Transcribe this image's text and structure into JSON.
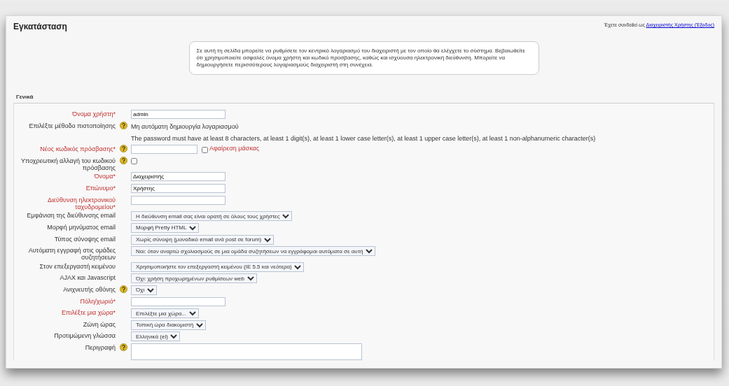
{
  "header": {
    "title": "Εγκατάσταση",
    "login_text": "Έχετε συνδεθεί ως",
    "login_link": "Διαχειριστής Χρήστης (Έξοδος)"
  },
  "intro": "Σε αυτή τη σελίδα μπορείτε να ρυθμίσετε τον κεντρικό λογαριασμό του διαχειριστή με τον οποίο θα ελέγχετε το σύστημα. Βεβαιωθείτε ότι χρησιμοποιείτε ασφαλές όνομα χρήστη και κωδικό πρόσβασης, καθώς και ισχύουσα ηλεκτρονική διεύθυνση. Μπορείτε να δημιουργήσετε περισσότερους λογαριασμούς διαχειριστή στη συνέχεια.",
  "section": {
    "legend": "Γενικά",
    "fields": [
      {
        "kind": "text",
        "label": "Όνομα χρήστη*",
        "required": true,
        "help": false,
        "value": "admin"
      },
      {
        "kind": "static",
        "label": "Επιλέξτε μέθοδο πιστοποίησης",
        "required": false,
        "help": true,
        "value": "Μη αυτόματη δημιουργία λογαριασμού"
      },
      {
        "kind": "static",
        "help": false,
        "value": "The password must have at least 8 characters, at least 1 digit(s), at least 1 lower case letter(s), at least 1 upper case letter(s), at least 1 non-alphanumeric character(s)"
      },
      {
        "kind": "password",
        "label": "Νέος κωδικός πρόσβασης*",
        "required": true,
        "help": true,
        "unmask": {
          "label": "Αφαίρεση μάσκας",
          "checked": false
        }
      },
      {
        "kind": "checkbox",
        "label": "Υποχρεωτική αλλαγή του κωδικού πρόσβασης",
        "required": false,
        "help": true,
        "checked": false
      },
      {
        "kind": "text",
        "label": "Όνομα*",
        "required": true,
        "help": false,
        "value": "Διαχειριστής"
      },
      {
        "kind": "text",
        "label": "Επώνυμο*",
        "required": true,
        "help": false,
        "value": "Χρήστης"
      },
      {
        "kind": "text",
        "label": "Διεύθυνση ηλεκτρονικού ταχυδρομείου*",
        "required": true,
        "help": false
      },
      {
        "kind": "select",
        "label": "Εμφάνιση της διεύθυνσης email",
        "required": false,
        "help": false,
        "value": "Η διεύθυνση email σας είναι ορατή σε όλους τους χρήστες"
      },
      {
        "kind": "select",
        "label": "Μορφή μηνύματος email",
        "required": false,
        "help": false,
        "value": "Μορφή Pretty HTML"
      },
      {
        "kind": "select",
        "label": "Τύπος σύνοψης email",
        "required": false,
        "help": false,
        "value": "Χωρίς σύνοψη (μοναδικό email ανά post σε forum)"
      },
      {
        "kind": "select",
        "label": "Αυτόματη εγγραφή στις ομάδες συζητήσεων",
        "required": false,
        "help": false,
        "value": "Ναι: όταν αναρτώ σχολιασμούς σε μια ομάδα συζητήσεων να εγγράφομαι αυτόματα σε αυτή"
      },
      {
        "kind": "select",
        "label": "Στον επεξεργαστή κειμένου",
        "required": false,
        "help": false,
        "value": "Χρησιμοποιήστε τον επεξεργαστή κειμένου (IE 5.5 και νεότερα)"
      },
      {
        "kind": "select",
        "label": "AJAX και Javascript",
        "required": false,
        "help": false,
        "value": "Όχι: χρήση προχωρημένων ρυθμίσεων web"
      },
      {
        "kind": "select",
        "label": "Ανιχνευτής οθόνης",
        "required": false,
        "help": true,
        "value": "Όχι"
      },
      {
        "kind": "text",
        "label": "Πόλη/χωριό*",
        "required": true,
        "help": false
      },
      {
        "kind": "select",
        "label": "Επιλέξτε μια χώρα*",
        "required": true,
        "help": false,
        "value": "Επιλέξτε μια χώρα..."
      },
      {
        "kind": "select",
        "label": "Ζώνη ώρας",
        "required": false,
        "help": false,
        "value": "Τοπική ώρα διακομιστή"
      },
      {
        "kind": "select",
        "label": "Προτιμώμενη γλώσσα",
        "required": false,
        "help": false,
        "value": "Ελληνικά (el)"
      },
      {
        "kind": "textarea",
        "label": "Περιγραφή",
        "required": false,
        "help": true
      }
    ]
  }
}
